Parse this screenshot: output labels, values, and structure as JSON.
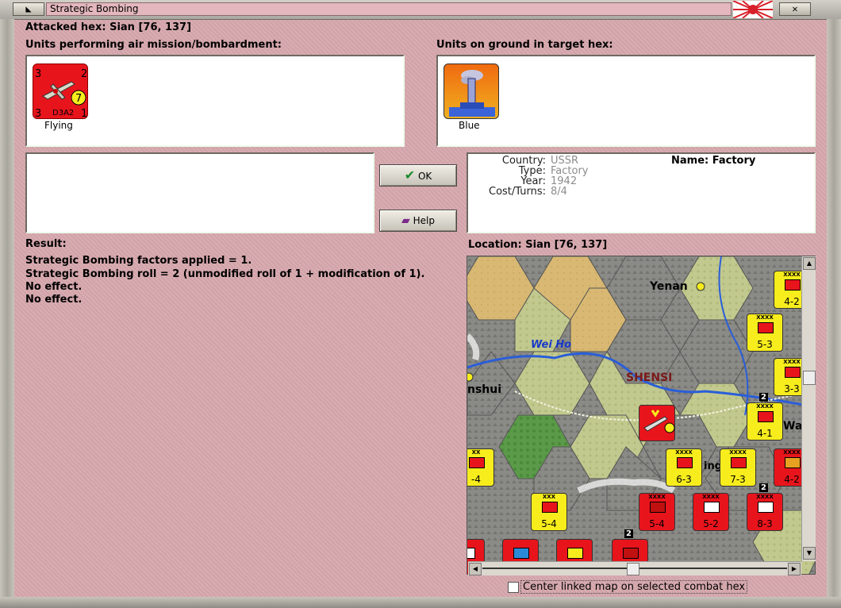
{
  "window": {
    "title": "Strategic Bombing"
  },
  "header": {
    "attacked_hex": "Attacked hex: Sian  [76, 137]"
  },
  "air_units": {
    "label": "Units performing air mission/bombardment:",
    "items": [
      {
        "name": "D3A2",
        "caption": "Flying",
        "top_left": "3",
        "top_right": "2",
        "bottom_left": "3",
        "bottom_right": "1",
        "badge": "7",
        "color": "#e8141c"
      }
    ]
  },
  "ground_units": {
    "label": "Units on ground in target hex:",
    "items": [
      {
        "caption": "Blue",
        "icon": "factory-icon"
      }
    ]
  },
  "buttons": {
    "ok": "OK",
    "help": "Help"
  },
  "target_info": {
    "country_key": "Country:",
    "country_val": "USSR",
    "type_key": "Type:",
    "type_val": "Factory",
    "year_key": "Year:",
    "year_val": "1942",
    "cost_key": "Cost/Turns:",
    "cost_val": "8/4",
    "name": "Name: Factory"
  },
  "result": {
    "label": "Result:",
    "lines": [
      "Strategic Bombing factors applied = 1.",
      "Strategic Bombing roll = 2 (unmodified roll of 1 + modification of 1).",
      "No effect.",
      "No effect."
    ]
  },
  "location": {
    "label": "Location:  Sian  [76, 137]"
  },
  "map": {
    "labels": {
      "yenan": "Yenan",
      "wei_ho": "Wei Ho",
      "shensi": "SHENSI",
      "anshui": "nshui",
      "wa": "Wa",
      "ing": "ing"
    },
    "units": [
      {
        "str": "4-2",
        "color": "#f7ec1c"
      },
      {
        "str": "5-3",
        "color": "#f7ec1c"
      },
      {
        "str": "3-3",
        "color": "#f7ec1c"
      },
      {
        "str": "4-1",
        "color": "#f7ec1c"
      },
      {
        "str": "6-3",
        "color": "#f7ec1c"
      },
      {
        "str": "7-3",
        "color": "#f7ec1c"
      },
      {
        "str": "4-2",
        "color": "#e8141c"
      },
      {
        "str": "5-4",
        "color": "#f7ec1c"
      },
      {
        "str": "5-4",
        "color": "#e8141c"
      },
      {
        "str": "5-2",
        "color": "#e8141c"
      },
      {
        "str": "8-3",
        "color": "#e8141c"
      },
      {
        "str": "-4",
        "color": "#f7ec1c"
      }
    ],
    "stack_counts": [
      "2",
      "2",
      "2"
    ]
  },
  "center_option": {
    "label": "Center linked map on selected combat hex",
    "checked": false
  }
}
